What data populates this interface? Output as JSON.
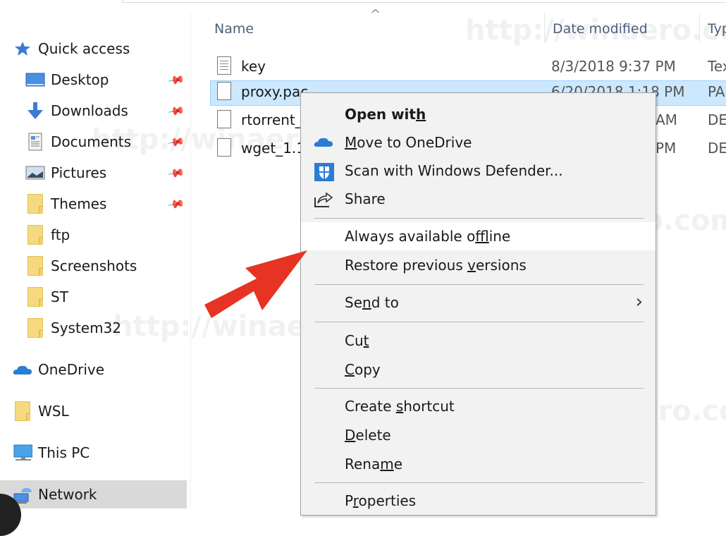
{
  "navigation": {
    "items": [
      {
        "label": "Quick access",
        "icon": "quick-access-star-icon",
        "pinned": false,
        "level": 0
      },
      {
        "label": "Desktop",
        "icon": "desktop-icon",
        "pinned": true,
        "level": 1
      },
      {
        "label": "Downloads",
        "icon": "downloads-arrow-icon",
        "pinned": true,
        "level": 1
      },
      {
        "label": "Documents",
        "icon": "documents-icon",
        "pinned": true,
        "level": 1
      },
      {
        "label": "Pictures",
        "icon": "pictures-icon",
        "pinned": true,
        "level": 1
      },
      {
        "label": "Themes",
        "icon": "folder-icon",
        "pinned": true,
        "level": 1
      },
      {
        "label": "ftp",
        "icon": "folder-icon",
        "pinned": false,
        "level": 1
      },
      {
        "label": "Screenshots",
        "icon": "folder-icon",
        "pinned": false,
        "level": 1
      },
      {
        "label": "ST",
        "icon": "folder-icon",
        "pinned": false,
        "level": 1
      },
      {
        "label": "System32",
        "icon": "folder-icon",
        "pinned": false,
        "level": 1
      },
      {
        "label": "OneDrive",
        "icon": "onedrive-cloud-icon",
        "pinned": false,
        "level": 0
      },
      {
        "label": "WSL",
        "icon": "folder-icon",
        "pinned": false,
        "level": 0
      },
      {
        "label": "This PC",
        "icon": "this-pc-monitor-icon",
        "pinned": false,
        "level": 0
      },
      {
        "label": "Network",
        "icon": "network-icon",
        "pinned": false,
        "level": 0,
        "selected": true
      }
    ]
  },
  "file_list": {
    "columns": {
      "name": "Name",
      "date_modified": "Date modified",
      "type": "Typ"
    },
    "sort_indicator": "^",
    "rows": [
      {
        "name": "key",
        "date": "8/3/2018 9:37 PM",
        "type": "Tex",
        "icon": "text-file-icon",
        "selected": false
      },
      {
        "name": "proxy.pac",
        "date": "6/20/2018 1:18 PM",
        "type": "PA",
        "icon": "file-icon",
        "selected": true
      },
      {
        "name": "rtorrent_",
        "date": "AM",
        "type": "DE",
        "icon": "file-icon",
        "selected": false
      },
      {
        "name": "wget_1.1",
        "date": "PM",
        "type": "DE",
        "icon": "file-icon",
        "selected": false
      }
    ]
  },
  "context_menu": {
    "groups": [
      [
        {
          "label": "Open with",
          "access_key": "h",
          "bold": true,
          "icon": null
        },
        {
          "label": "Move to OneDrive",
          "access_key": "M",
          "icon": "onedrive-cloud-icon"
        },
        {
          "label": "Scan with Windows Defender...",
          "access_key": null,
          "icon": "windows-defender-shield-icon"
        },
        {
          "label": "Share",
          "access_key": null,
          "icon": "share-icon"
        }
      ],
      [
        {
          "label": "Always available offline",
          "access_key": "f",
          "hover": true
        },
        {
          "label": "Restore previous versions",
          "access_key": "v"
        }
      ],
      [
        {
          "label": "Send to",
          "access_key": "n",
          "submenu": true
        }
      ],
      [
        {
          "label": "Cut",
          "access_key": "t"
        },
        {
          "label": "Copy",
          "access_key": "C"
        }
      ],
      [
        {
          "label": "Create shortcut",
          "access_key": "s"
        },
        {
          "label": "Delete",
          "access_key": "D"
        },
        {
          "label": "Rename",
          "access_key": "m"
        }
      ],
      [
        {
          "label": "Properties",
          "access_key": "r"
        }
      ]
    ]
  },
  "annotation": {
    "arrow_color": "#e63323",
    "points_to": "Always available offline"
  },
  "watermark": {
    "text": "http://winaero.com"
  },
  "colors": {
    "selection_bg": "#cce8ff",
    "selection_border": "#99d1ff",
    "menu_bg": "#f2f2f2",
    "folder": "#f6d97f",
    "accent": "#2b7cd3"
  }
}
